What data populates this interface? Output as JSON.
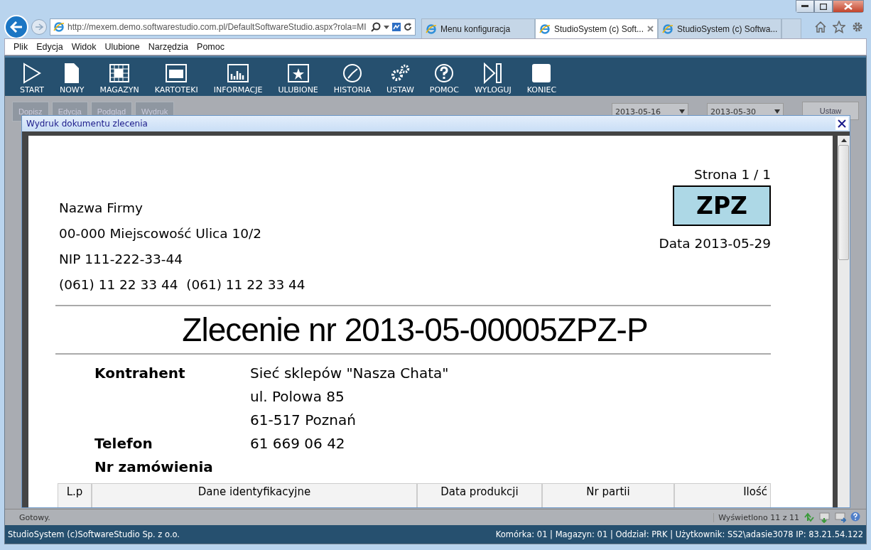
{
  "browser": {
    "address": "http://mexem.demo.softwarestudio.com.pl/DefaultSoftwareStudio.aspx?rola=MI",
    "tabs": [
      {
        "label": "Menu konfiguracja",
        "selected": false
      },
      {
        "label": "StudioSystem (c) Soft...",
        "selected": true
      },
      {
        "label": "StudioSystem (c) Softwa...",
        "selected": false
      }
    ],
    "menu": [
      "Plik",
      "Edycja",
      "Widok",
      "Ulubione",
      "Narzędzia",
      "Pomoc"
    ]
  },
  "toolbar": [
    {
      "label": "START",
      "kind": "play"
    },
    {
      "label": "NOWY",
      "kind": "page"
    },
    {
      "label": "MAGAZYN",
      "kind": "grid"
    },
    {
      "label": "KARTOTEKI",
      "kind": "window"
    },
    {
      "label": "INFORMACJE",
      "kind": "bars"
    },
    {
      "label": "ULUBIONE",
      "kind": "star"
    },
    {
      "label": "HISTORIA",
      "kind": "history"
    },
    {
      "label": "USTAW",
      "kind": "gears"
    },
    {
      "label": "POMOC",
      "kind": "help"
    },
    {
      "label": "WYLOGUJ",
      "kind": "logout"
    },
    {
      "label": "KONIEC",
      "kind": "square"
    }
  ],
  "actions": [
    "Dopisz",
    "Edycja",
    "Podgląd",
    "Wydruk"
  ],
  "date_from": "2013-05-16",
  "date_to": "2013-05-30",
  "apply": "Ustaw",
  "dialog": {
    "title": "Wydruk dokumentu zlecenia",
    "page_label": "Strona 1 / 1",
    "company": [
      "Nazwa Firmy",
      "00-000 Miejscowość Ulica 10/2",
      "NIP 111-222-33-44",
      "(061) 11 22 33 44  (061) 11 22 33 44"
    ],
    "doc_code": "ZPZ",
    "date": "Data 2013-05-29",
    "heading": "Zlecenie nr 2013-05-00005ZPZ-P",
    "details": [
      {
        "label": "Kontrahent",
        "values": [
          "Sieć sklepów \"Nasza Chata\"",
          "ul. Polowa 85",
          "61-517 Poznań"
        ]
      },
      {
        "label": "Telefon",
        "values": [
          "61 669 06 42"
        ]
      },
      {
        "label": "Nr zamówienia"
      }
    ],
    "table": {
      "columns": [
        "L.p",
        "Dane identyfikacyjne",
        "Data produkcji",
        "Nr partii",
        "Ilość"
      ]
    }
  },
  "status": {
    "text": "Gotowy.",
    "count": "Wyświetlono 11 z 11"
  },
  "footer": {
    "left": "StudioSystem (c)SoftwareStudio Sp. z o.o.",
    "right": "Komórka: 01 | Magazyn: 01 | Oddział: PRK | Użytkownik: SS2\\adasie3078 IP: 83.21.54.122"
  }
}
